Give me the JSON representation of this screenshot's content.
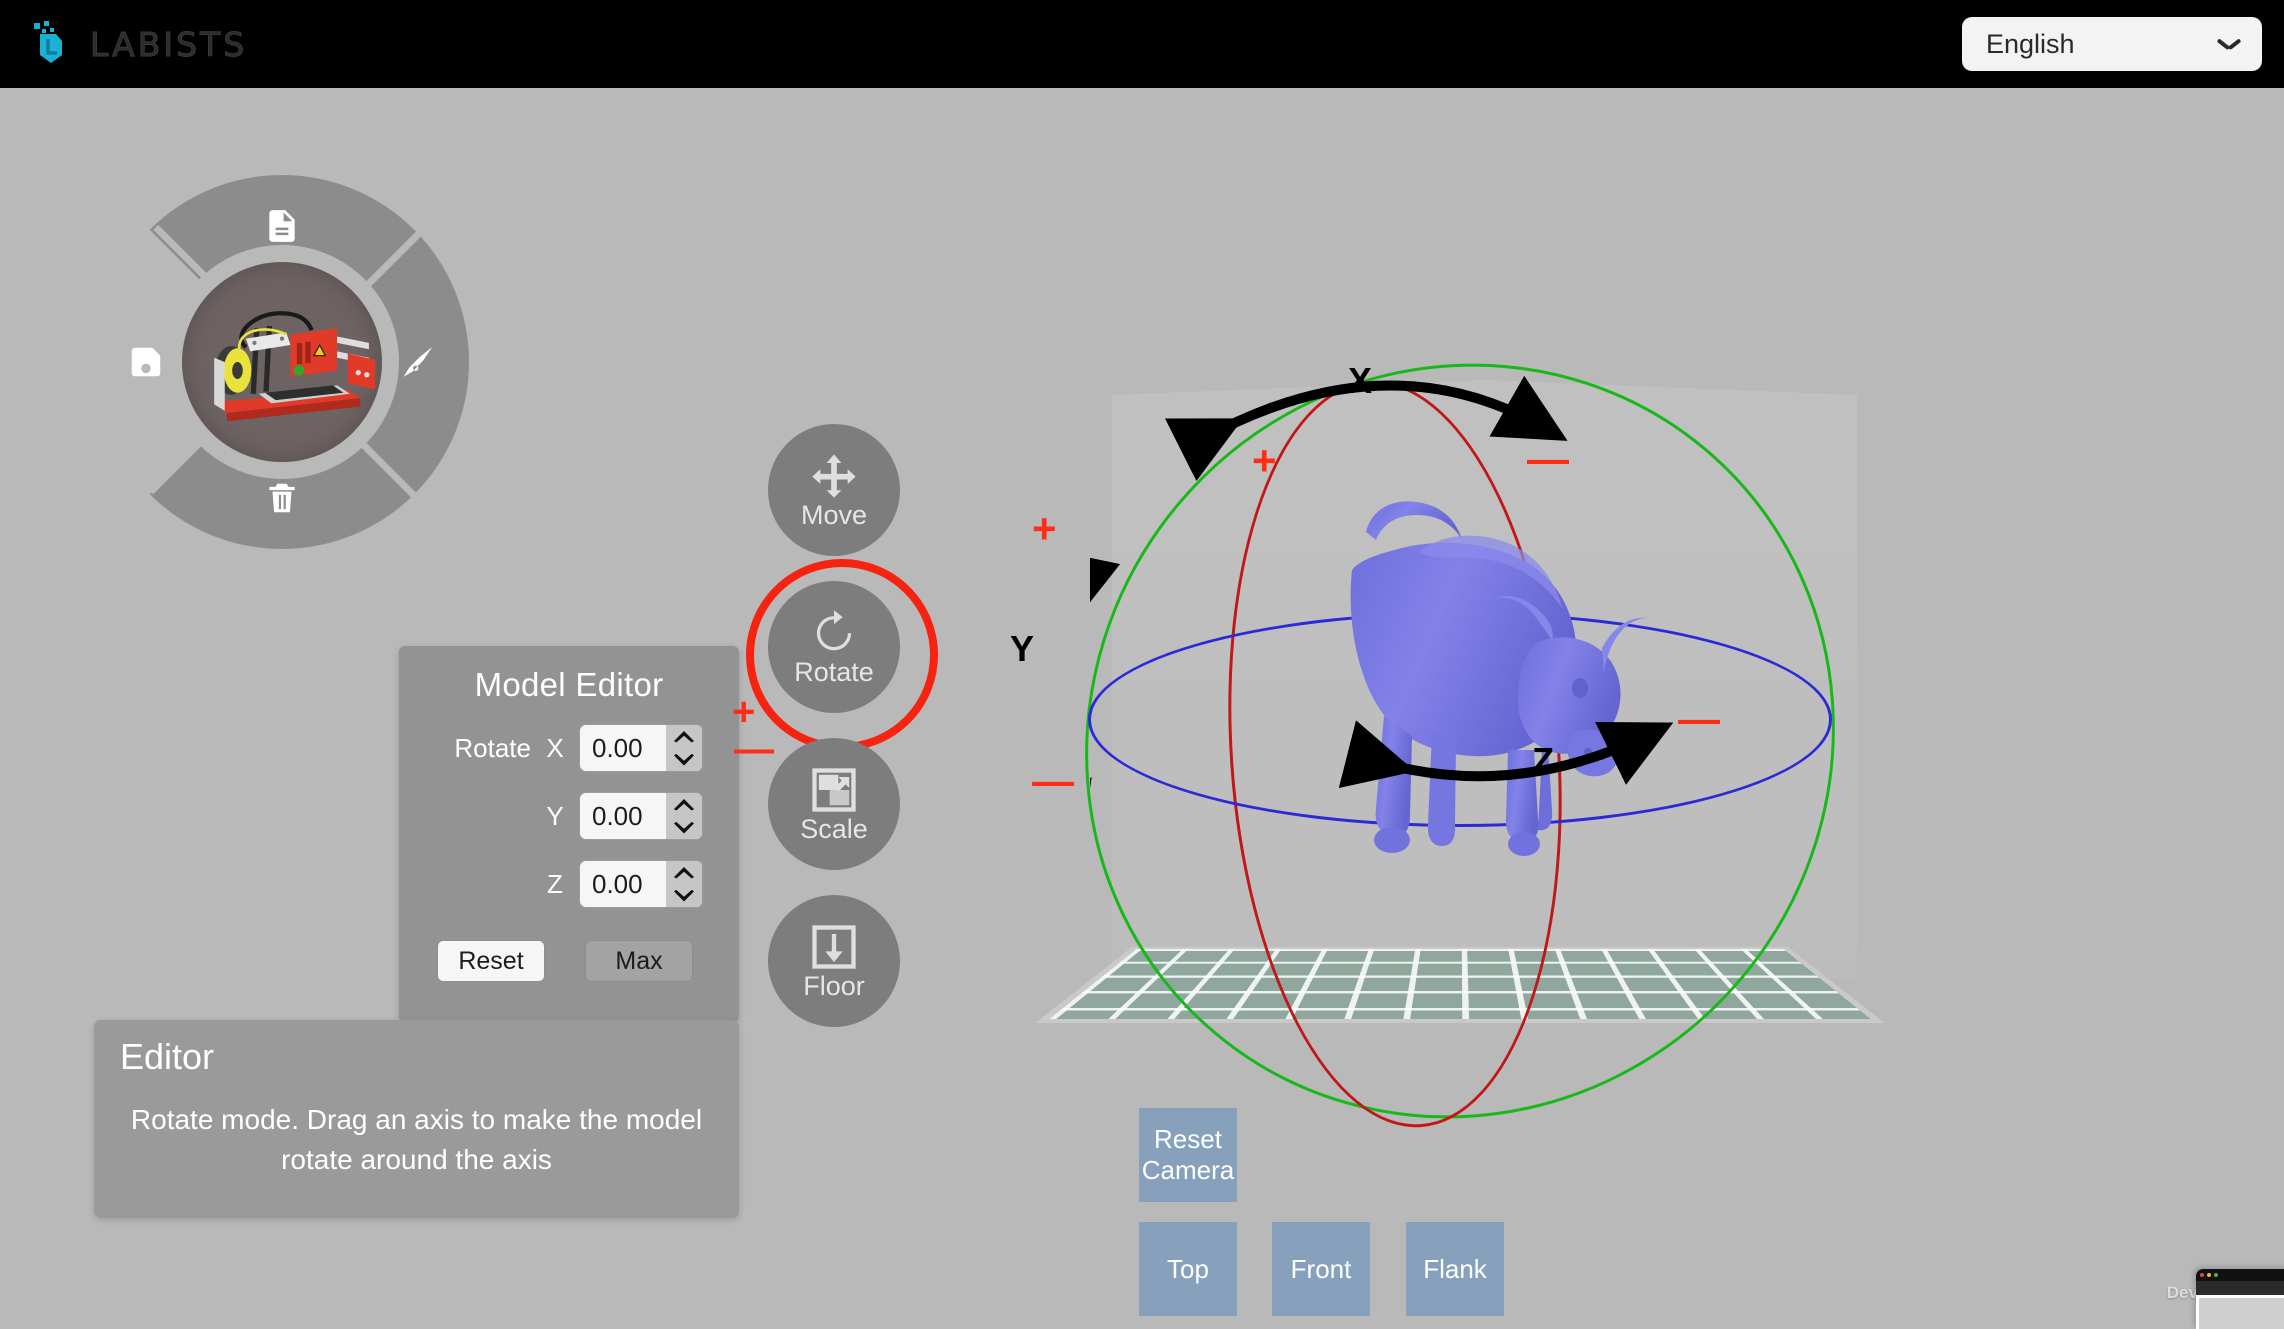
{
  "topbar": {
    "brand_name": "LABISTS",
    "brand_icon": "labists-hex-logo",
    "language": {
      "selected": "English",
      "icon": "chevron-down-icon"
    }
  },
  "radial_menu": {
    "items": [
      {
        "id": "open-file",
        "icon": "document-icon",
        "position": "top"
      },
      {
        "id": "save-file",
        "icon": "floppy-save-icon",
        "position": "left"
      },
      {
        "id": "slice-model",
        "icon": "pen-nib-slice-icon",
        "position": "right"
      },
      {
        "id": "delete-model",
        "icon": "trash-icon",
        "position": "bottom"
      }
    ],
    "center_icon": "3d-printer-preview"
  },
  "tools": [
    {
      "id": "move",
      "label": "Move",
      "icon": "move-arrows-icon",
      "selected": false
    },
    {
      "id": "rotate",
      "label": "Rotate",
      "icon": "rotate-circle-icon",
      "selected": true
    },
    {
      "id": "scale",
      "label": "Scale",
      "icon": "scale-square-icon",
      "selected": false
    },
    {
      "id": "floor",
      "label": "Floor",
      "icon": "floor-down-arrow-icon",
      "selected": false
    }
  ],
  "model_editor": {
    "title": "Model Editor",
    "mode_label": "Rotate",
    "fields": [
      {
        "axis": "X",
        "value": "0.00",
        "prefix": "Rotate"
      },
      {
        "axis": "Y",
        "value": "0.00",
        "prefix": ""
      },
      {
        "axis": "Z",
        "value": "0.00",
        "prefix": ""
      }
    ],
    "plus_sign": "+",
    "minus_sign": "—",
    "buttons": {
      "reset": "Reset",
      "max": "Max"
    }
  },
  "hint_panel": {
    "title": "Editor",
    "message": "Rotate mode. Drag an axis to make the model rotate around the axis"
  },
  "viewport": {
    "model_name": "bull-3d-model",
    "model_color": "#7b7be0",
    "bed_color": "#8fa79c",
    "axes": [
      {
        "name": "X",
        "ring_color": "#19b819",
        "plus": "+",
        "minus": "—"
      },
      {
        "name": "Y",
        "ring_color": "#19b819",
        "plus": "+",
        "minus": "—"
      },
      {
        "name": "Z",
        "ring_color": "#2a2ad6",
        "plus": "+",
        "minus": "—"
      }
    ]
  },
  "camera_buttons": [
    {
      "id": "reset-camera",
      "label": "Reset Camera"
    },
    {
      "id": "top",
      "label": "Top"
    },
    {
      "id": "front",
      "label": "Front"
    },
    {
      "id": "flank",
      "label": "Flank"
    }
  ],
  "watermark": {
    "text": "Developm"
  },
  "colors": {
    "background": "#b9b9b9",
    "topbar": "#000000",
    "accent_red": "#ff2d16",
    "panel_gray": "#939393",
    "camera_button": "#87a0bc",
    "brand_cyan": "#19b1d4"
  }
}
